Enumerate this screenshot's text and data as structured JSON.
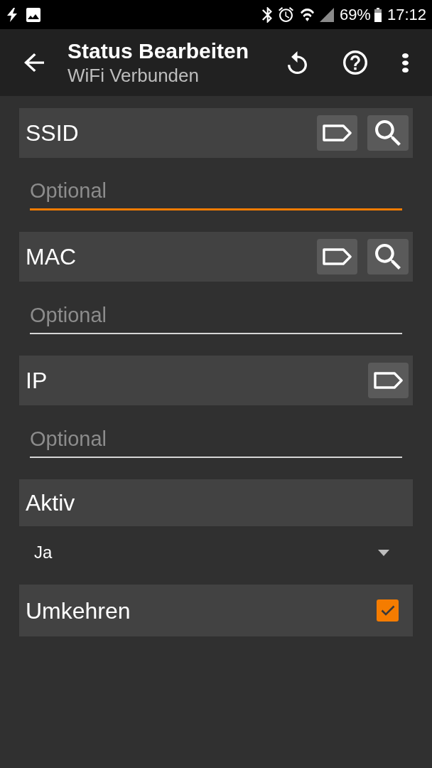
{
  "status_bar": {
    "battery": "69%",
    "time": "17:12"
  },
  "app_bar": {
    "title": "Status Bearbeiten",
    "subtitle": "WiFi Verbunden"
  },
  "fields": [
    {
      "kind": "text",
      "label": "SSID",
      "search_button": true,
      "placeholder": "Optional",
      "focused": true
    },
    {
      "kind": "text",
      "label": "MAC",
      "search_button": true,
      "placeholder": "Optional",
      "focused": false
    },
    {
      "kind": "text",
      "label": "IP",
      "search_button": false,
      "placeholder": "Optional",
      "focused": false
    },
    {
      "kind": "select",
      "label": "Aktiv",
      "value": "Ja"
    },
    {
      "kind": "checkbox",
      "label": "Umkehren",
      "checked": true
    }
  ]
}
